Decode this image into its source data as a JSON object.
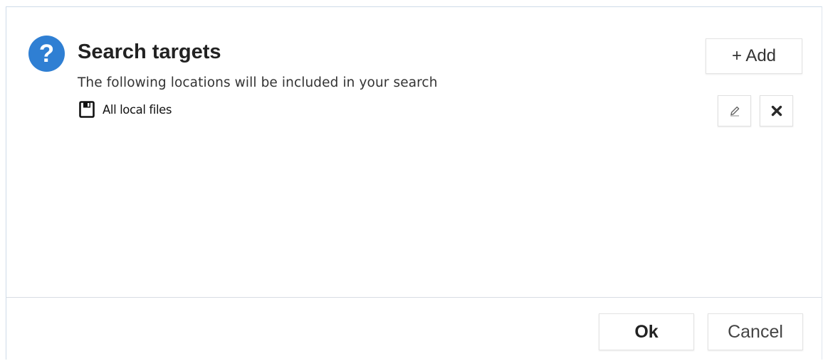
{
  "dialog": {
    "title": "Search targets",
    "subtitle": "The following locations will be included in your search",
    "icon": "question-circle-icon",
    "accent_color": "#2f7fd3"
  },
  "targets": [
    {
      "icon": "floppy-disk-icon",
      "label": "All local files"
    }
  ],
  "toolbar": {
    "add_label": "+ Add",
    "edit_icon": "pencil-icon",
    "delete_icon": "close-x-icon"
  },
  "footer": {
    "ok_label": "Ok",
    "cancel_label": "Cancel"
  }
}
